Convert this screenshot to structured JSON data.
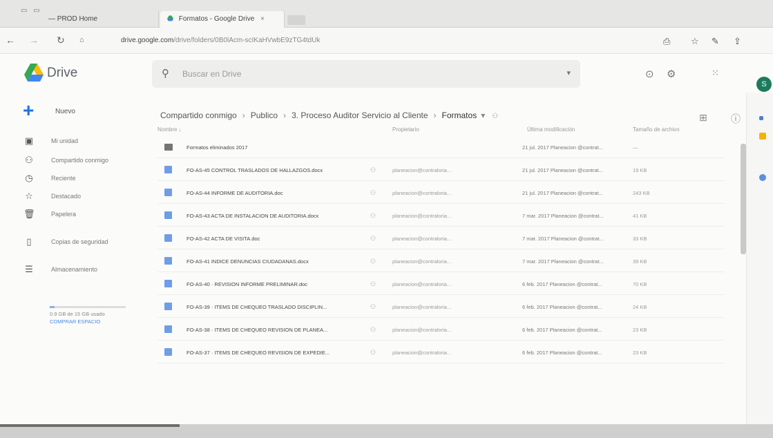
{
  "browser": {
    "window_title": "— PROD Home",
    "tabs": [
      {
        "label": "— PROD Home"
      },
      {
        "label": "Formatos - Google Drive",
        "close": "×"
      }
    ],
    "url_host": "drive.google.com",
    "url_path": "/drive/folders/0B0lAcm-scIKaHVwbE9zTG4tdUk"
  },
  "drive": {
    "logo_text": "Drive",
    "search_placeholder": "Buscar en Drive",
    "avatar_initial": "S",
    "new_button": "Nuevo",
    "nav": [
      {
        "label": "Mi unidad",
        "icon": "my-drive-icon"
      },
      {
        "label": "Compartido conmigo",
        "icon": "shared-icon"
      },
      {
        "label": "Reciente",
        "icon": "recent-icon"
      },
      {
        "label": "Destacado",
        "icon": "star-icon"
      },
      {
        "label": "Papelera",
        "icon": "trash-icon"
      },
      {
        "label": "Copias de seguridad",
        "icon": "backup-icon"
      },
      {
        "label": "Almacenamiento",
        "icon": "storage-icon"
      }
    ],
    "storage": {
      "used_fraction": 0.06,
      "text": "0.9 GB de 15 GB usado",
      "link": "COMPRAR ESPACIO"
    },
    "breadcrumb": [
      "Compartido conmigo",
      "Publico",
      "3. Proceso Auditor Servicio al Cliente",
      "Formatos"
    ],
    "columns": {
      "name": "Nombre ↓",
      "owner": "Propietario",
      "modified": "Última modificación",
      "size": "Tamaño de archivo"
    },
    "files": [
      {
        "type": "folder",
        "name": "Formatos eliminados 2017",
        "owner": "",
        "modified": "21 jul. 2017 Planeacion @contrat...",
        "size": "—"
      },
      {
        "type": "doc",
        "name": "FO-AS-45 CONTROL TRASLADOS DE HALLAZGOS.docx",
        "owner": "planeacion@contraloria...",
        "modified": "21 jul. 2017 Planeacion @contrat...",
        "size": "19 KB"
      },
      {
        "type": "doc",
        "name": "FO-AS-44 INFORME DE AUDITORIA.doc",
        "owner": "planeacion@contraloria...",
        "modified": "21 jul. 2017 Planeacion @contrat...",
        "size": "243 KB"
      },
      {
        "type": "doc",
        "name": "FO-AS-43 ACTA DE INSTALACION DE AUDITORIA.docx",
        "owner": "planeacion@contraloria...",
        "modified": "7 mar. 2017 Planeacion @contrat...",
        "size": "41 KB"
      },
      {
        "type": "doc",
        "name": "FO-AS-42 ACTA DE VISITA.doc",
        "owner": "planeacion@contraloria...",
        "modified": "7 mar. 2017 Planeacion @contrat...",
        "size": "33 KB"
      },
      {
        "type": "doc",
        "name": "FO-AS-41 INDICE DENUNCIAS CIUDADANAS.docx",
        "owner": "planeacion@contraloria...",
        "modified": "7 mar. 2017 Planeacion @contrat...",
        "size": "39 KB"
      },
      {
        "type": "doc",
        "name": "FO-AS-40 · REVISION INFORME PRELIMINAR.doc",
        "owner": "planeacion@contraloria...",
        "modified": "6 feb. 2017 Planeacion @contrat...",
        "size": "70 KB"
      },
      {
        "type": "doc",
        "name": "FO-AS-39 · ITEMS DE CHEQUEO TRASLADO DISCIPLIN...",
        "owner": "planeacion@contraloria...",
        "modified": "6 feb. 2017 Planeacion @contrat...",
        "size": "24 KB"
      },
      {
        "type": "doc",
        "name": "FO-AS-38 · ITEMS DE CHEQUEO REVISION DE PLANEA...",
        "owner": "planeacion@contraloria...",
        "modified": "6 feb. 2017 Planeacion @contrat...",
        "size": "23 KB"
      },
      {
        "type": "doc",
        "name": "FO-AS-37 · ITEMS DE CHEQUEO REVISION DE EXPEDIE...",
        "owner": "planeacion@contraloria...",
        "modified": "6 feb. 2017 Planeacion @contrat...",
        "size": "23 KB"
      }
    ]
  }
}
